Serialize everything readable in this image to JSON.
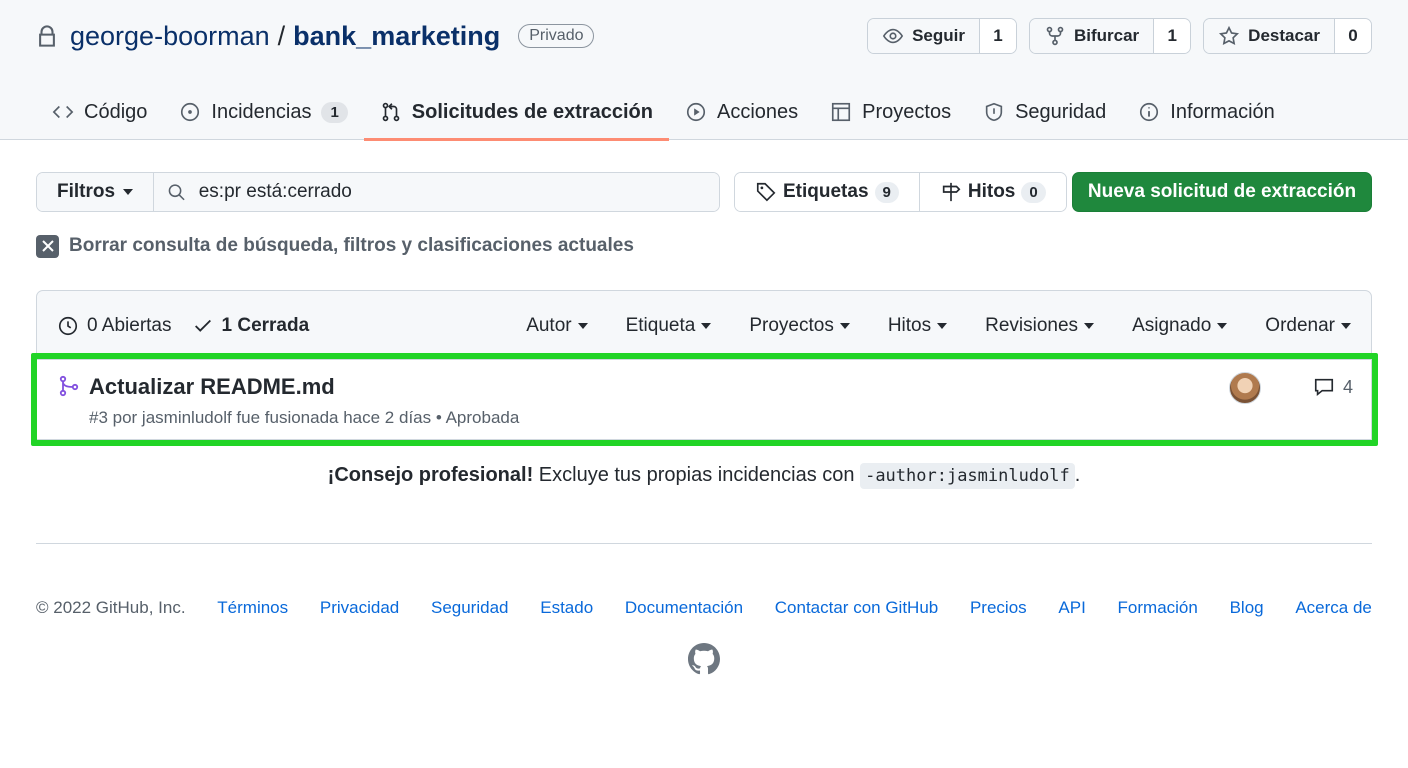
{
  "repo": {
    "owner": "george-boorman",
    "separator": "/",
    "name": "bank_marketing",
    "visibility": "Privado"
  },
  "actions": {
    "watch": {
      "label": "Seguir",
      "count": "1"
    },
    "fork": {
      "label": "Bifurcar",
      "count": "1"
    },
    "star": {
      "label": "Destacar",
      "count": "0"
    }
  },
  "tabs": [
    {
      "label": "Código",
      "icon": "code-icon"
    },
    {
      "label": "Incidencias",
      "icon": "issue-icon",
      "count": "1"
    },
    {
      "label": "Solicitudes de extracción",
      "icon": "pull-request-icon",
      "selected": true
    },
    {
      "label": "Acciones",
      "icon": "play-icon"
    },
    {
      "label": "Proyectos",
      "icon": "table-icon"
    },
    {
      "label": "Seguridad",
      "icon": "shield-icon"
    },
    {
      "label": "Información",
      "icon": "info-icon"
    }
  ],
  "filters": {
    "button_label": "Filtros",
    "search_value": "es:pr está:cerrado",
    "labels": {
      "label": "Etiquetas",
      "count": "9"
    },
    "milestones": {
      "label": "Hitos",
      "count": "0"
    },
    "new_pr_label": "Nueva solicitud de extracción"
  },
  "clear_query": "Borrar consulta de búsqueda, filtros y clasificaciones actuales",
  "list_header": {
    "open": "0 Abiertas",
    "closed": "1 Cerrada",
    "sorts": [
      "Autor",
      "Etiqueta",
      "Proyectos",
      "Hitos",
      "Revisiones",
      "Asignado",
      "Ordenar"
    ]
  },
  "pull_request": {
    "title": "Actualizar README.md",
    "meta": "#3 por jasminludolf fue fusionada hace 2 días • Aprobada",
    "comments": "4"
  },
  "tip": {
    "bold": "¡Consejo profesional!",
    "text": " Excluye tus propias incidencias con ",
    "code": "-author:jasminludolf",
    "end": "."
  },
  "footer": {
    "copyright": "© 2022 GitHub, Inc.",
    "links": [
      "Términos",
      "Privacidad",
      "Seguridad",
      "Estado",
      "Documentación",
      "Contactar con GitHub",
      "Precios",
      "API",
      "Formación",
      "Blog",
      "Acerca de"
    ]
  },
  "colors": {
    "accent_green": "#1f883d",
    "highlight_green": "#21d426",
    "tab_underline": "#fd8c73",
    "merged_purple": "#8250df"
  }
}
